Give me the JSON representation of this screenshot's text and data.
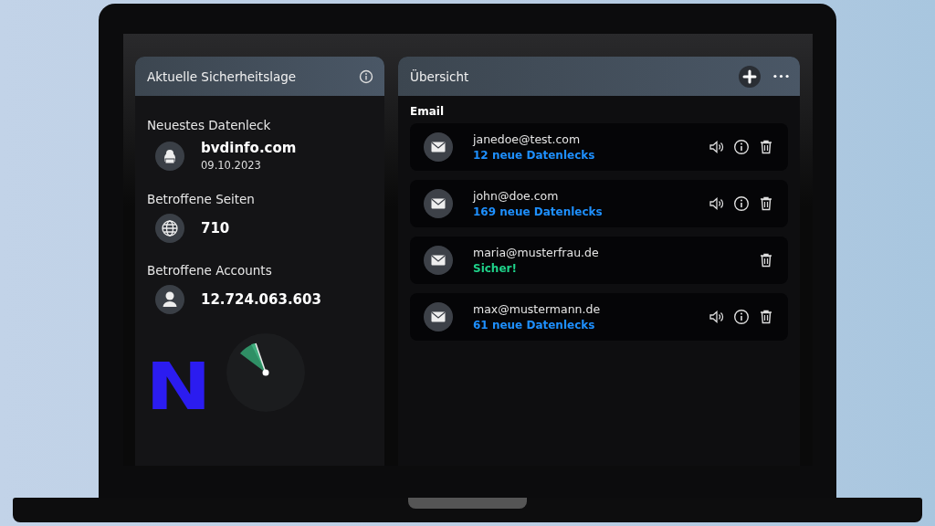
{
  "security_panel": {
    "title": "Aktuelle Sicherheitslage",
    "latest_breach": {
      "label": "Neuestes Datenleck",
      "site": "bvdinfo.com",
      "date": "09.10.2023"
    },
    "affected_sites": {
      "label": "Betroffene Seiten",
      "value": "710"
    },
    "affected_accounts": {
      "label": "Betroffene Accounts",
      "value": "12.724.063.603"
    },
    "logo_text": "N"
  },
  "overview_panel": {
    "title": "Übersicht",
    "section": "Email",
    "emails": [
      {
        "address": "janedoe@test.com",
        "status": "12 neue Datenlecks",
        "kind": "leaks"
      },
      {
        "address": "john@doe.com",
        "status": "169 neue Datenlecks",
        "kind": "leaks"
      },
      {
        "address": "maria@musterfrau.de",
        "status": "Sicher!",
        "kind": "safe"
      },
      {
        "address": "max@mustermann.de",
        "status": "61 neue Datenlecks",
        "kind": "leaks"
      }
    ]
  }
}
